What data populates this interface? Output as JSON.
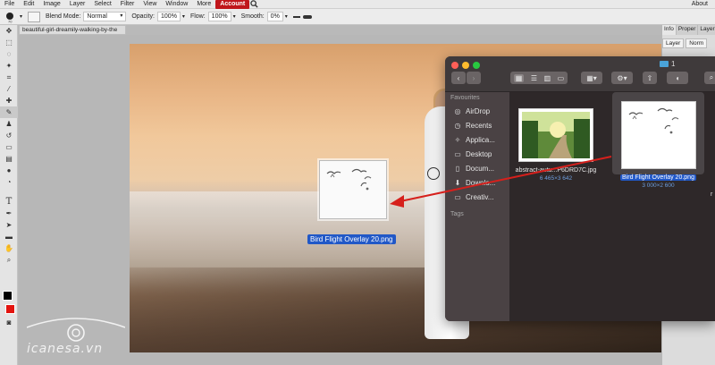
{
  "menu": {
    "items": [
      "File",
      "Edit",
      "Image",
      "Layer",
      "Select",
      "Filter",
      "View",
      "Window",
      "More"
    ],
    "account": "Account",
    "about": "About"
  },
  "options": {
    "blend_label": "Blend Mode:",
    "blend_value": "Normal",
    "opacity_label": "Opacity:",
    "opacity_value": "100%",
    "flow_label": "Flow:",
    "flow_value": "100%",
    "smooth_label": "Smooth:",
    "smooth_value": "0%"
  },
  "document": {
    "tab_title": "beautiful-girl-dreamily-walking-by-the"
  },
  "right_panel": {
    "tabs": [
      "Info",
      "Proper",
      "Layer"
    ],
    "sub": [
      "Layer",
      "Norm"
    ]
  },
  "dragged_file": {
    "label": "Bird Flight Overlay 20.png"
  },
  "finder": {
    "folder_name": "1",
    "favourites_header": "Favourites",
    "sidebar_items": [
      {
        "label": "AirDrop",
        "icon": "airdrop-icon"
      },
      {
        "label": "Recents",
        "icon": "clock-icon"
      },
      {
        "label": "Applica...",
        "icon": "applications-icon"
      },
      {
        "label": "Desktop",
        "icon": "desktop-icon"
      },
      {
        "label": "Docum...",
        "icon": "document-icon"
      },
      {
        "label": "Downlo...",
        "icon": "download-icon"
      },
      {
        "label": "Creativ...",
        "icon": "folder-icon"
      }
    ],
    "tags_header": "Tags",
    "files": [
      {
        "name": "abstract-autu...P6DRD7C.jpg",
        "dims": "6 465×3 642"
      },
      {
        "name": "Bird Flight Overlay 20.png",
        "dims": "3 000×2 600"
      }
    ],
    "partial_file": "r"
  },
  "watermark": {
    "text": "icanesa.vn"
  },
  "colors": {
    "accent": "#c0161b",
    "selection": "#2158c7",
    "foreground": "#000000",
    "background": "#e3140f",
    "drag_arrow": "#d6201c"
  }
}
